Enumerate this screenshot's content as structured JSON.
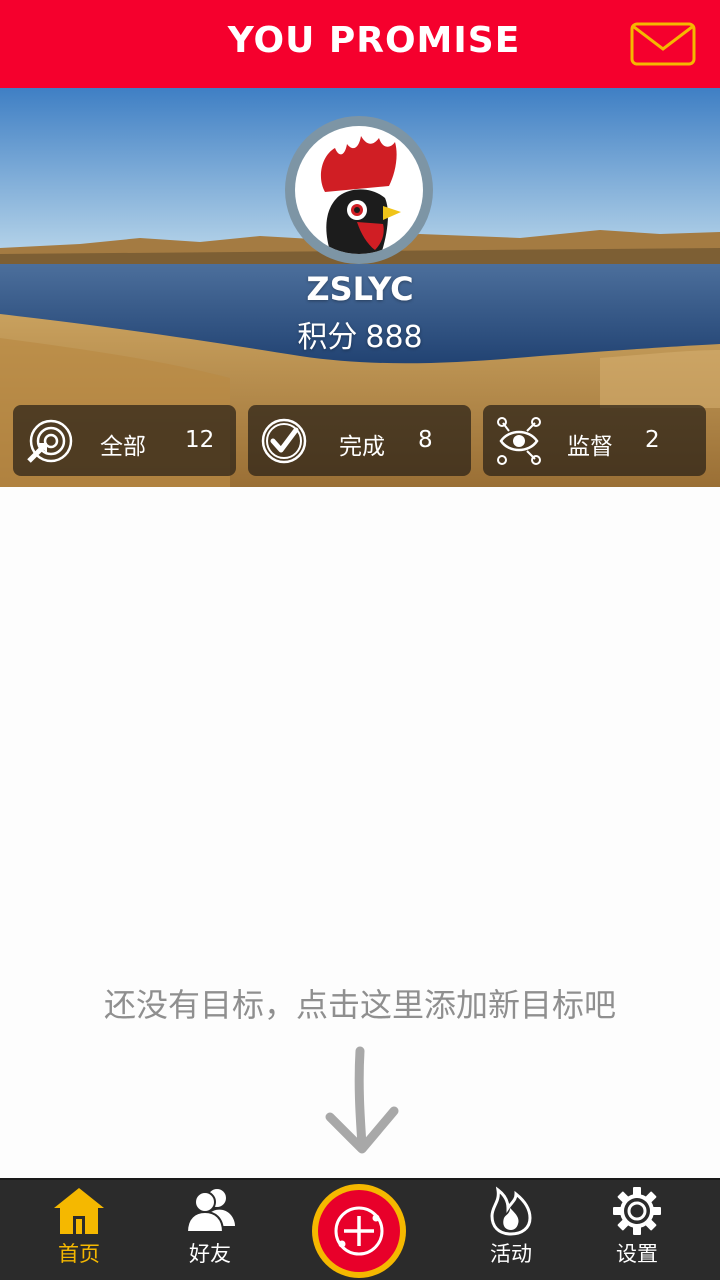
{
  "header": {
    "title": "YOU PROMISE",
    "mail_icon": "mail-icon"
  },
  "profile": {
    "username": "ZSLYC",
    "points_label": "积分",
    "points_value": "888"
  },
  "stats": [
    {
      "label": "全部",
      "count": "12",
      "icon": "target-arrow-icon"
    },
    {
      "label": "完成",
      "count": "8",
      "icon": "check-circle-icon"
    },
    {
      "label": "监督",
      "count": "2",
      "icon": "eye-network-icon"
    }
  ],
  "empty_state": {
    "message": "还没有目标，点击这里添加新目标吧"
  },
  "tabbar": {
    "items": [
      {
        "label": "首页",
        "icon": "home-icon",
        "active": true
      },
      {
        "label": "好友",
        "icon": "friends-icon",
        "active": false
      },
      {
        "label": "",
        "icon": "add-goal-icon",
        "active": false
      },
      {
        "label": "活动",
        "icon": "flame-icon",
        "active": false
      },
      {
        "label": "设置",
        "icon": "gear-icon",
        "active": false
      }
    ]
  },
  "colors": {
    "brand_red": "#f5002d",
    "accent_yellow": "#f5b800",
    "tabbar_bg": "#2b2b2b"
  }
}
